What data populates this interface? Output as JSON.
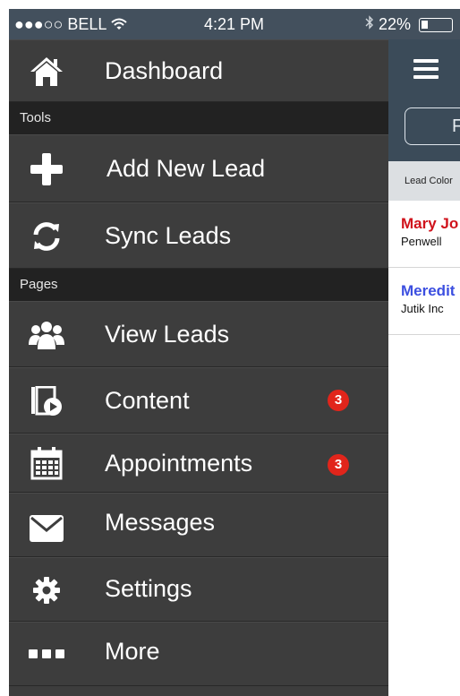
{
  "status_bar": {
    "carrier": "●●●○○ BELL",
    "time": "4:21 PM",
    "battery": "22%",
    "battery_level": 0.22,
    "icons": [
      "wifi-icon",
      "bluetooth-icon",
      "battery-icon"
    ]
  },
  "menu": {
    "sections": [
      {
        "header": "Tools"
      },
      {
        "header": "Pages"
      }
    ],
    "items": [
      {
        "label": "Dashboard",
        "icon": "home-icon"
      },
      {
        "label": "Add New Lead",
        "icon": "plus-icon"
      },
      {
        "label": "Sync Leads",
        "icon": "sync-icon"
      },
      {
        "label": "View Leads",
        "icon": "users-icon"
      },
      {
        "label": "Content",
        "icon": "content-play-icon",
        "badge": "3"
      },
      {
        "label": "Appointments",
        "icon": "calendar-icon",
        "badge": "3"
      },
      {
        "label": "Messages",
        "icon": "envelope-icon"
      },
      {
        "label": "Settings",
        "icon": "gear-icon"
      },
      {
        "label": "More",
        "icon": "ellipsis-icon"
      }
    ]
  },
  "main": {
    "filter_button": "F",
    "lead_color_label": "Lead Color",
    "leads": [
      {
        "name": "Mary Jo",
        "company": "Penwell",
        "color": "#d0121b"
      },
      {
        "name": "Meredit",
        "company": "Jutik Inc",
        "color": "#3c4fe0"
      }
    ]
  },
  "colors": {
    "menu_bg": "#3d3d3d",
    "section_bg": "#222222",
    "header_bg": "#3b4b59",
    "badge": "#e1251b"
  }
}
